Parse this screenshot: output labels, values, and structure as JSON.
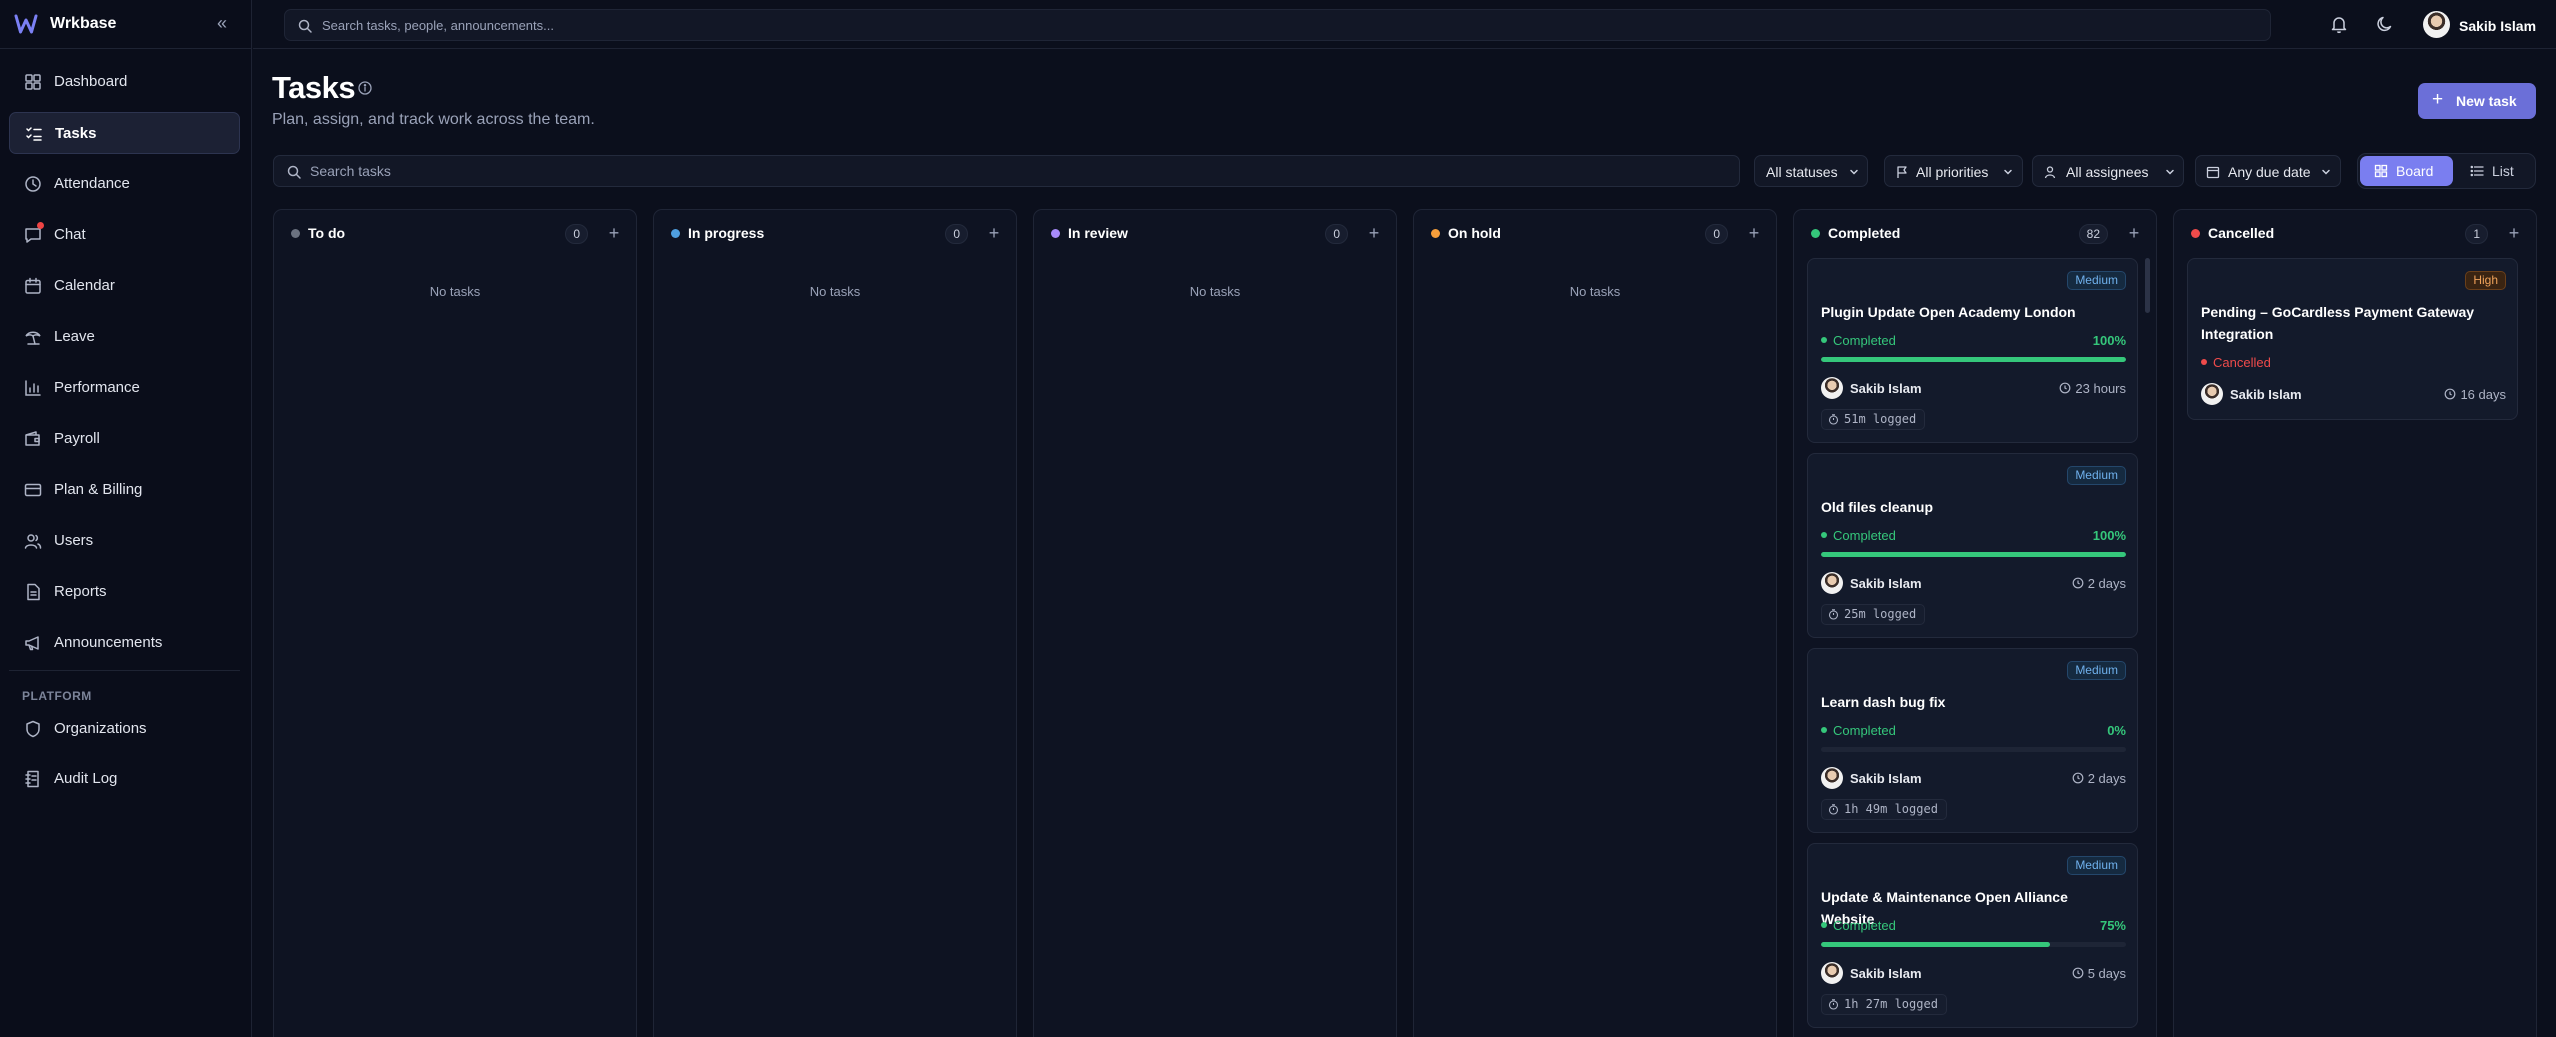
{
  "app": {
    "name": "Wrkbase",
    "collapse_icon": "chevrons-left-icon"
  },
  "sidebar": {
    "items": [
      {
        "label": "Dashboard",
        "icon": "dashboard-icon"
      },
      {
        "label": "Tasks",
        "icon": "tasks-icon",
        "active": true
      },
      {
        "label": "Attendance",
        "icon": "clock-icon"
      },
      {
        "label": "Chat",
        "icon": "chat-icon",
        "badge": "unread-dot"
      },
      {
        "label": "Calendar",
        "icon": "calendar-icon"
      },
      {
        "label": "Leave",
        "icon": "leave-icon"
      },
      {
        "label": "Performance",
        "icon": "bar-chart-icon"
      },
      {
        "label": "Payroll",
        "icon": "wallet-icon"
      },
      {
        "label": "Plan & Billing",
        "icon": "credit-card-icon"
      },
      {
        "label": "Users",
        "icon": "users-icon"
      },
      {
        "label": "Reports",
        "icon": "file-text-icon"
      },
      {
        "label": "Announcements",
        "icon": "megaphone-icon"
      }
    ],
    "section_label": "PLATFORM",
    "platform_items": [
      {
        "label": "Organizations",
        "icon": "shield-icon"
      },
      {
        "label": "Audit Log",
        "icon": "audit-log-icon"
      }
    ]
  },
  "topbar": {
    "search_placeholder": "Search tasks, people, announcements...",
    "user_name": "Sakib Islam"
  },
  "header": {
    "title": "Tasks",
    "subtitle": "Plan, assign, and track work across the team.",
    "new_task_label": "New task"
  },
  "filters": {
    "search_placeholder": "Search tasks",
    "status": "All statuses",
    "priority": "All priorities",
    "assignee": "All assignees",
    "due": "Any due date"
  },
  "views": {
    "board": "Board",
    "list": "List",
    "active": "Board"
  },
  "columns": [
    {
      "title": "To do",
      "count": "0",
      "empty": "No tasks",
      "color": "#6b7280"
    },
    {
      "title": "In progress",
      "count": "0",
      "empty": "No tasks",
      "color": "#4f9fe0"
    },
    {
      "title": "In review",
      "count": "0",
      "empty": "No tasks",
      "color": "#a78bfa"
    },
    {
      "title": "On hold",
      "count": "0",
      "empty": "No tasks",
      "color": "#f59e3b"
    },
    {
      "title": "Completed",
      "count": "82",
      "color": "#35c77b",
      "cards": [
        {
          "priority": "Medium",
          "title": "Plugin Update Open Academy London",
          "status": "Completed",
          "percent": "100%",
          "progress": 1.0,
          "assignee": "Sakib Islam",
          "due": "23 hours",
          "logged": "51m logged"
        },
        {
          "priority": "Medium",
          "title": "Old files cleanup",
          "status": "Completed",
          "percent": "100%",
          "progress": 1.0,
          "assignee": "Sakib Islam",
          "due": "2 days",
          "logged": "25m logged"
        },
        {
          "priority": "Medium",
          "title": "Learn dash bug fix",
          "status": "Completed",
          "percent": "0%",
          "progress": 0.0,
          "assignee": "Sakib Islam",
          "due": "2 days",
          "logged": "1h 49m logged"
        },
        {
          "priority": "Medium",
          "title": "Update & Maintenance Open Alliance Website",
          "status": "Completed",
          "percent": "75%",
          "progress": 0.75,
          "assignee": "Sakib Islam",
          "due": "5 days",
          "logged": "1h 27m logged"
        }
      ]
    },
    {
      "title": "Cancelled",
      "count": "1",
      "color": "#ef4b4b",
      "cards": [
        {
          "priority": "High",
          "title": "Pending – GoCardless Payment Gateway Integration",
          "status": "Cancelled",
          "assignee": "Sakib Islam",
          "due": "16 days"
        }
      ]
    }
  ]
}
